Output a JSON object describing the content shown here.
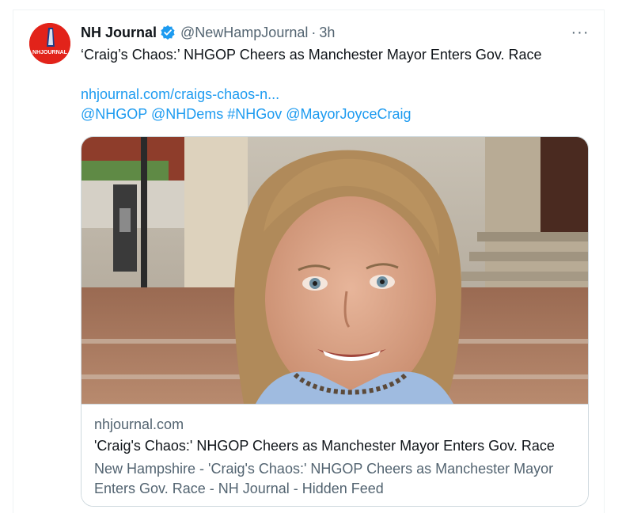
{
  "tweet": {
    "display_name": "NH Journal",
    "handle": "@NewHampJournal",
    "separator": "·",
    "time": "3h",
    "more_label": "···",
    "avatar_text": "NHJOURNAL",
    "text_line": "‘Craig’s Chaos:’ NHGOP Cheers as Manchester Mayor Enters Gov. Race",
    "link_text": "nhjournal.com/craigs-chaos-n...",
    "mentions": "@NHGOP @NHDems #NHGov @MayorJoyceCraig"
  },
  "card": {
    "domain": "nhjournal.com",
    "title": "'Craig's Chaos:' NHGOP Cheers as Manchester Mayor Enters Gov. Race",
    "description": "New Hampshire - 'Craig's Chaos:' NHGOP Cheers as Manchester Mayor Enters Gov. Race - NH Journal - Hidden Feed"
  },
  "colors": {
    "link": "#1d9bf0",
    "verified": "#1d9bf0",
    "avatar": "#e2231a",
    "secondary_text": "#536471"
  },
  "icons": [
    "verified-badge-icon",
    "more-options-icon"
  ]
}
